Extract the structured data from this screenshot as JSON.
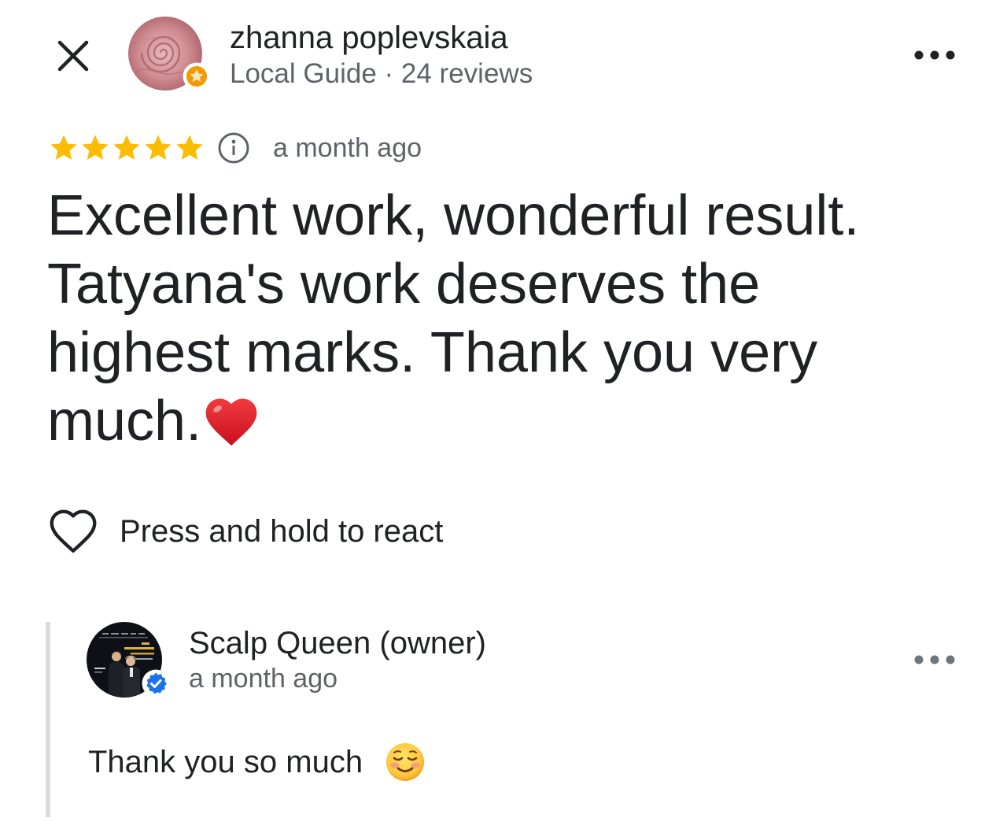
{
  "header": {
    "close_icon": "close-icon",
    "more_icon": "more-options-icon",
    "reviewer": {
      "name": "zhanna poplevskaia",
      "subtitle": "Local Guide · 24 reviews",
      "avatar_icon": "rose-avatar",
      "badge_icon": "local-guide-badge-icon"
    }
  },
  "review": {
    "rating": 5,
    "max_rating": 5,
    "info_icon": "info-icon",
    "time": "a month ago",
    "text": "Excellent work, wonderful result. Tatyana's work deserves the highest marks. Thank you very much.",
    "emoji_icon": "red-heart-icon"
  },
  "react": {
    "icon": "heart-outline-icon",
    "label": "Press and hold to react"
  },
  "owner_reply": {
    "name": "Scalp Queen (owner)",
    "time": "a month ago",
    "text": "Thank you so much",
    "emoji_icon": "smiling-face-icon",
    "badge_icon": "verified-badge-icon",
    "more_icon": "more-options-icon"
  },
  "colors": {
    "star_filled": "#fbbc04",
    "star_empty": "#dadce0",
    "text_primary": "#202124",
    "text_secondary": "#5f6368",
    "verified_blue": "#1a73e8",
    "heart_red": "#e0202a"
  }
}
